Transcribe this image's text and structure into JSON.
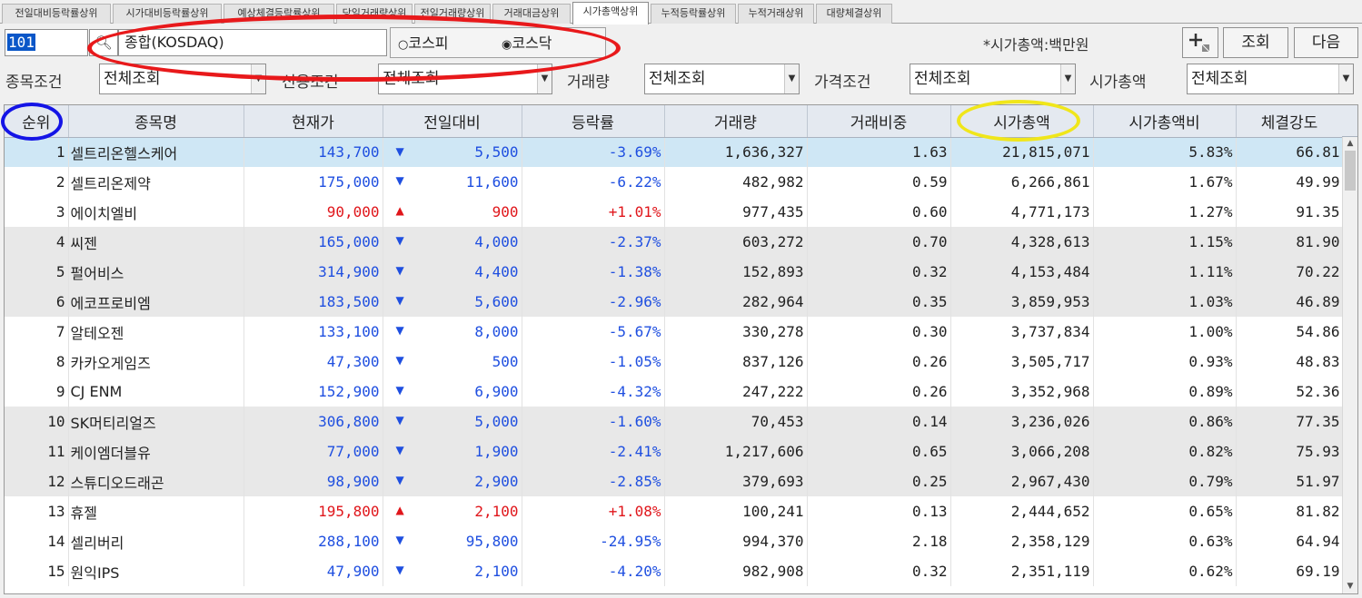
{
  "tabs": [
    "전일대비등락률상위",
    "시가대비등락률상위",
    "예상체결등락률상위",
    "당일거래량상위",
    "전일거래량상위",
    "거래대금상위",
    "시가총액상위",
    "누적등락률상위",
    "누적거래상위",
    "대량체결상위"
  ],
  "active_tab": 6,
  "toolbar": {
    "code": "101",
    "search_icon": "magnifier-icon",
    "market_name": "종합(KOSDAQ)",
    "radio_kospi": "코스피",
    "radio_kosdaq": "코스닥",
    "mcap_unit": "*시가총액:백만원",
    "add_icon": "add-icon",
    "query_label": "조회",
    "next_label": "다음"
  },
  "conditions": [
    {
      "label": "종목조건",
      "value": "전체조회"
    },
    {
      "label": "신용조건",
      "value": "전체조회"
    },
    {
      "label": "거래량",
      "value": "전체조회"
    },
    {
      "label": "가격조건",
      "value": "전체조회"
    },
    {
      "label": "시가총액",
      "value": "전체조회"
    }
  ],
  "columns": [
    "순위",
    "종목명",
    "현재가",
    "전일대비",
    "등락률",
    "거래량",
    "거래비중",
    "시가총액",
    "시가총액비",
    "체결강도"
  ],
  "rows": [
    {
      "rank": "1",
      "name": "셀트리온헬스케어",
      "price": "143,700",
      "dir": "down",
      "change": "5,500",
      "rate": "-3.69%",
      "volume": "1,636,327",
      "ratio": "1.63",
      "mcap": "21,815,071",
      "mcap_ratio": "5.83%",
      "strength": "66.81"
    },
    {
      "rank": "2",
      "name": "셀트리온제약",
      "price": "175,000",
      "dir": "down",
      "change": "11,600",
      "rate": "-6.22%",
      "volume": "482,982",
      "ratio": "0.59",
      "mcap": "6,266,861",
      "mcap_ratio": "1.67%",
      "strength": "49.99"
    },
    {
      "rank": "3",
      "name": "에이치엘비",
      "price": "90,000",
      "dir": "up",
      "change": "900",
      "rate": "+1.01%",
      "volume": "977,435",
      "ratio": "0.60",
      "mcap": "4,771,173",
      "mcap_ratio": "1.27%",
      "strength": "91.35"
    },
    {
      "rank": "4",
      "name": "씨젠",
      "price": "165,000",
      "dir": "down",
      "change": "4,000",
      "rate": "-2.37%",
      "volume": "603,272",
      "ratio": "0.70",
      "mcap": "4,328,613",
      "mcap_ratio": "1.15%",
      "strength": "81.90"
    },
    {
      "rank": "5",
      "name": "펄어비스",
      "price": "314,900",
      "dir": "down",
      "change": "4,400",
      "rate": "-1.38%",
      "volume": "152,893",
      "ratio": "0.32",
      "mcap": "4,153,484",
      "mcap_ratio": "1.11%",
      "strength": "70.22"
    },
    {
      "rank": "6",
      "name": "에코프로비엠",
      "price": "183,500",
      "dir": "down",
      "change": "5,600",
      "rate": "-2.96%",
      "volume": "282,964",
      "ratio": "0.35",
      "mcap": "3,859,953",
      "mcap_ratio": "1.03%",
      "strength": "46.89"
    },
    {
      "rank": "7",
      "name": "알테오젠",
      "price": "133,100",
      "dir": "down",
      "change": "8,000",
      "rate": "-5.67%",
      "volume": "330,278",
      "ratio": "0.30",
      "mcap": "3,737,834",
      "mcap_ratio": "1.00%",
      "strength": "54.86"
    },
    {
      "rank": "8",
      "name": "카카오게임즈",
      "price": "47,300",
      "dir": "down",
      "change": "500",
      "rate": "-1.05%",
      "volume": "837,126",
      "ratio": "0.26",
      "mcap": "3,505,717",
      "mcap_ratio": "0.93%",
      "strength": "48.83"
    },
    {
      "rank": "9",
      "name": "CJ ENM",
      "price": "152,900",
      "dir": "down",
      "change": "6,900",
      "rate": "-4.32%",
      "volume": "247,222",
      "ratio": "0.26",
      "mcap": "3,352,968",
      "mcap_ratio": "0.89%",
      "strength": "52.36"
    },
    {
      "rank": "10",
      "name": "SK머티리얼즈",
      "price": "306,800",
      "dir": "down",
      "change": "5,000",
      "rate": "-1.60%",
      "volume": "70,453",
      "ratio": "0.14",
      "mcap": "3,236,026",
      "mcap_ratio": "0.86%",
      "strength": "77.35"
    },
    {
      "rank": "11",
      "name": "케이엠더블유",
      "price": "77,000",
      "dir": "down",
      "change": "1,900",
      "rate": "-2.41%",
      "volume": "1,217,606",
      "ratio": "0.65",
      "mcap": "3,066,208",
      "mcap_ratio": "0.82%",
      "strength": "75.93"
    },
    {
      "rank": "12",
      "name": "스튜디오드래곤",
      "price": "98,900",
      "dir": "down",
      "change": "2,900",
      "rate": "-2.85%",
      "volume": "379,693",
      "ratio": "0.25",
      "mcap": "2,967,430",
      "mcap_ratio": "0.79%",
      "strength": "51.97"
    },
    {
      "rank": "13",
      "name": "휴젤",
      "price": "195,800",
      "dir": "up",
      "change": "2,100",
      "rate": "+1.08%",
      "volume": "100,241",
      "ratio": "0.13",
      "mcap": "2,444,652",
      "mcap_ratio": "0.65%",
      "strength": "81.82"
    },
    {
      "rank": "14",
      "name": "셀리버리",
      "price": "288,100",
      "dir": "down",
      "change": "95,800",
      "rate": "-24.95%",
      "volume": "994,370",
      "ratio": "2.18",
      "mcap": "2,358,129",
      "mcap_ratio": "0.63%",
      "strength": "64.94"
    },
    {
      "rank": "15",
      "name": "원익IPS",
      "price": "47,900",
      "dir": "down",
      "change": "2,100",
      "rate": "-4.20%",
      "volume": "982,908",
      "ratio": "0.32",
      "mcap": "2,351,119",
      "mcap_ratio": "0.62%",
      "strength": "69.19"
    }
  ],
  "colors": {
    "up": "#e0161b",
    "down": "#1f4fe0",
    "selected_row": "#cfe7f5",
    "header": "#e4e9f0",
    "red_ring": "#e8191b",
    "blue_ring": "#1414e6",
    "yellow_ring": "#f0e61a"
  }
}
